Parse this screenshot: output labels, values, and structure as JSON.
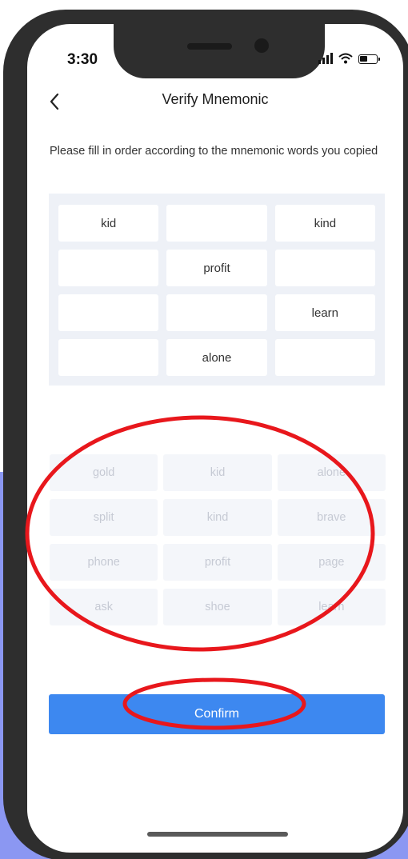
{
  "status_bar": {
    "time": "3:30"
  },
  "header": {
    "title": "Verify Mnemonic",
    "back_icon": "chevron-left-icon"
  },
  "instruction": "Please fill in order according to the mnemonic words you copied",
  "answer_slots": [
    "kid",
    "",
    "kind",
    "",
    "profit",
    "",
    "",
    "",
    "learn",
    "",
    "alone",
    ""
  ],
  "word_options": [
    "gold",
    "kid",
    "alone",
    "split",
    "kind",
    "brave",
    "phone",
    "profit",
    "page",
    "ask",
    "shoe",
    "learn"
  ],
  "confirm_label": "Confirm",
  "colors": {
    "accent": "#3d88f0",
    "annotation": "#e8171c",
    "backdrop": "#8b97f2",
    "device_frame": "#2e2e2e"
  }
}
